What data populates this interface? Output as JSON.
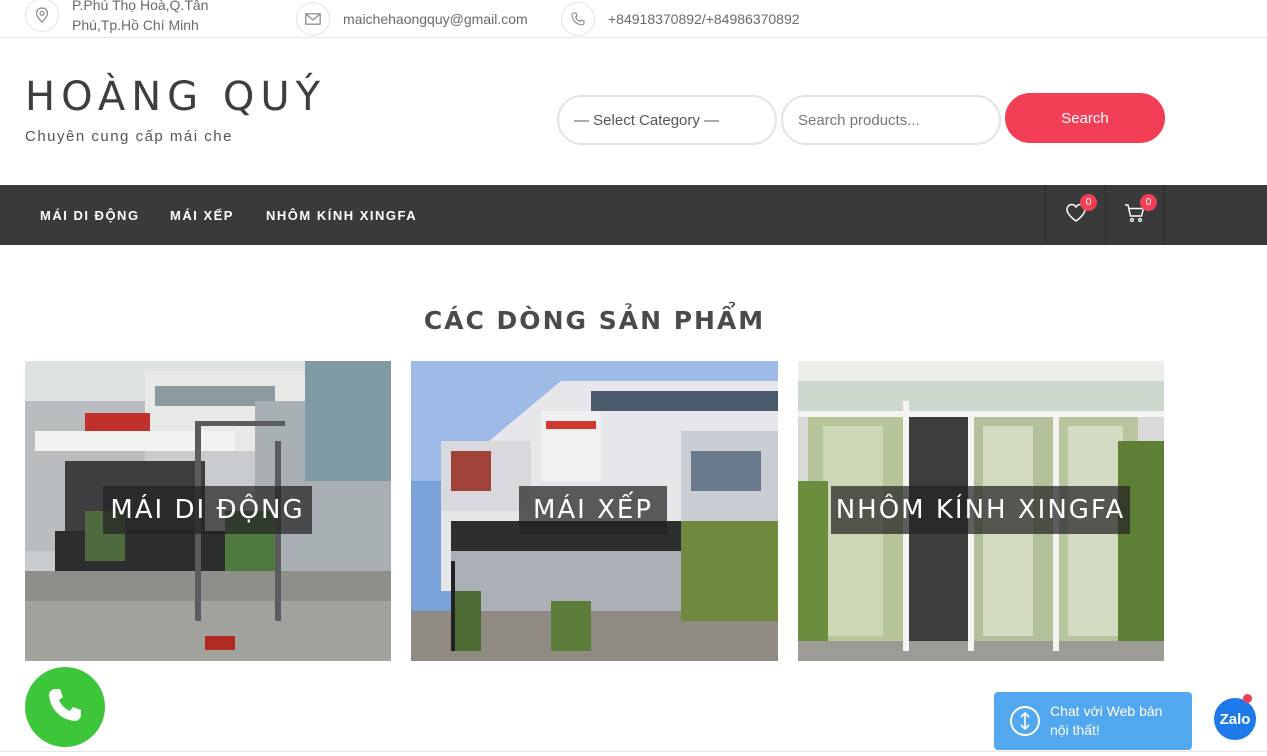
{
  "topbar": {
    "address": "P.Phú Thọ Hoà,Q.Tân Phú,Tp.Hồ Chí Minh",
    "email": "maichehaongquy@gmail.com",
    "phone": "+84918370892/+84986370892",
    "icons": [
      "location-pin-icon",
      "envelope-icon",
      "phone-icon"
    ]
  },
  "header": {
    "site_title": "HOÀNG QUÝ",
    "tagline": "Chuyên cung cấp mái che",
    "category_select": "— Select Category —",
    "search_placeholder": "Search products...",
    "search_button": "Search",
    "accent_color": "#f33f55"
  },
  "nav": {
    "items": [
      {
        "label": "MÁI DI ĐỘNG"
      },
      {
        "label": "MÁI XẾP"
      },
      {
        "label": "NHÔM KÍNH XINGFA"
      }
    ],
    "wishlist_count": "0",
    "cart_count": "0",
    "background": "#3a3a3a"
  },
  "main": {
    "section_title": "CÁC DÒNG SẢN PHẨM",
    "products": [
      {
        "label": "MÁI DI ĐỘNG"
      },
      {
        "label": "MÁI XẾP"
      },
      {
        "label": "NHÔM KÍNH XINGFA"
      }
    ]
  },
  "floating": {
    "zalo_chat": "Chat với Web bán nội thất!",
    "zalo_logo": "Zalo",
    "call_color": "#3ec63b",
    "zalo_color": "#52a8ef"
  }
}
